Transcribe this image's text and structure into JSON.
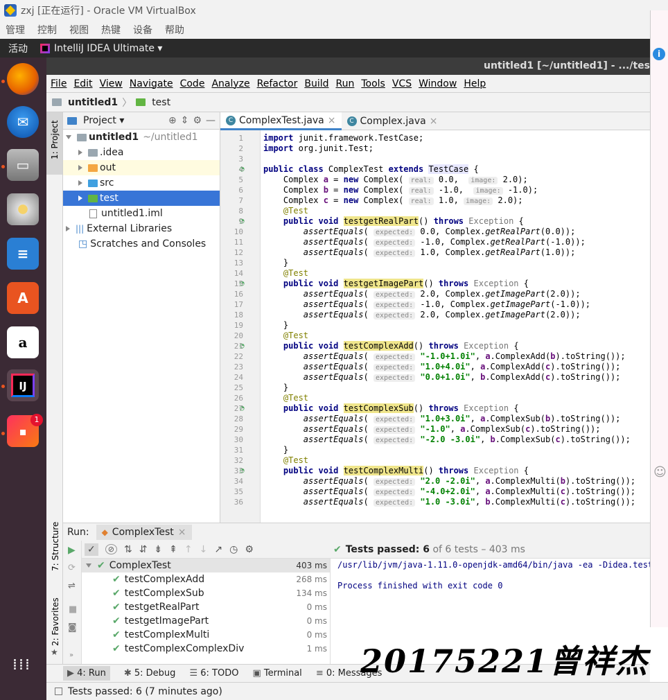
{
  "vbox": {
    "title": "zxj [正在运行] - Oracle VM VirtualBox",
    "menu": [
      "管理",
      "控制",
      "视图",
      "热键",
      "设备",
      "帮助"
    ]
  },
  "gnome": {
    "activities": "活动",
    "app": "IntelliJ IDEA Ultimate ▾"
  },
  "ide": {
    "title": "untitled1 [~/untitled1] - .../tes",
    "menu": [
      "File",
      "Edit",
      "View",
      "Navigate",
      "Code",
      "Analyze",
      "Refactor",
      "Build",
      "Run",
      "Tools",
      "VCS",
      "Window",
      "Help"
    ],
    "breadcrumb": [
      "untitled1",
      "test"
    ]
  },
  "dock": {
    "badge": "1"
  },
  "left_stripe": {
    "project": "1: Project",
    "structure": "7: Structure",
    "favorites": "2: Favorites"
  },
  "project": {
    "header": "Project ▾",
    "tree": [
      {
        "label": "untitled1",
        "extra": "~/untitled1",
        "icon": "folder",
        "level": 0,
        "expanded": true
      },
      {
        "label": ".idea",
        "icon": "folder",
        "level": 1
      },
      {
        "label": "out",
        "icon": "folder-orange",
        "level": 1
      },
      {
        "label": "src",
        "icon": "folder-blue",
        "level": 1
      },
      {
        "label": "test",
        "icon": "folder-green",
        "level": 1
      },
      {
        "label": "untitled1.iml",
        "icon": "file",
        "level": 1
      },
      {
        "label": "External Libraries",
        "icon": "library",
        "level": 0
      },
      {
        "label": "Scratches and Consoles",
        "icon": "scratch",
        "level": 0
      }
    ]
  },
  "editor": {
    "tabs": [
      {
        "label": "ComplexTest.java",
        "active": true
      },
      {
        "label": "Complex.java",
        "active": false
      }
    ],
    "lines": [
      "1",
      "2",
      "3",
      "4",
      "5",
      "6",
      "7",
      "8",
      "9",
      "10",
      "11",
      "12",
      "13",
      "14",
      "15",
      "16",
      "17",
      "18",
      "19",
      "20",
      "21",
      "22",
      "23",
      "24",
      "25",
      "26",
      "27",
      "28",
      "29",
      "30",
      "31",
      "32",
      "33",
      "34",
      "35",
      "36"
    ]
  },
  "run": {
    "label": "Run:",
    "tab": "ComplexTest",
    "status_bold": "Tests passed: 6",
    "status_rest": " of 6 tests – 403 ms",
    "tree": [
      {
        "name": "ComplexTest",
        "time": "403 ms",
        "root": true
      },
      {
        "name": "testComplexAdd",
        "time": "268 ms"
      },
      {
        "name": "testComplexSub",
        "time": "134 ms"
      },
      {
        "name": "testgetRealPart",
        "time": "0 ms"
      },
      {
        "name": "testgetImagePart",
        "time": "0 ms"
      },
      {
        "name": "testComplexMulti",
        "time": "0 ms"
      },
      {
        "name": "testComplexComplexDiv",
        "time": "1 ms"
      }
    ],
    "console": [
      "/usr/lib/jvm/java-1.11.0-openjdk-amd64/bin/java -ea -Didea.test.c",
      "",
      "Process finished with exit code 0"
    ]
  },
  "bottom_tabs": [
    "4: Run",
    "5: Debug",
    "6: TODO",
    "Terminal",
    "0: Messages"
  ],
  "status": "Tests passed: 6 (7 minutes ago)",
  "watermark": "20175221曾祥杰",
  "colors": {
    "selection": "#3875d7",
    "pass": "#59a869",
    "keyword": "#000080",
    "string": "#008000"
  }
}
